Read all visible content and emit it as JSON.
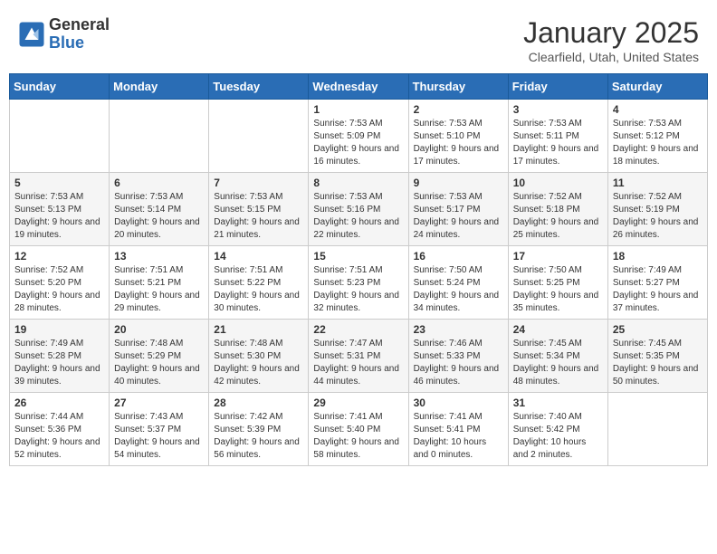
{
  "logo": {
    "general": "General",
    "blue": "Blue"
  },
  "header": {
    "month": "January 2025",
    "location": "Clearfield, Utah, United States"
  },
  "weekdays": [
    "Sunday",
    "Monday",
    "Tuesday",
    "Wednesday",
    "Thursday",
    "Friday",
    "Saturday"
  ],
  "weeks": [
    [
      {
        "day": "",
        "info": ""
      },
      {
        "day": "",
        "info": ""
      },
      {
        "day": "",
        "info": ""
      },
      {
        "day": "1",
        "sunrise": "7:53 AM",
        "sunset": "5:09 PM",
        "daylight": "9 hours and 16 minutes."
      },
      {
        "day": "2",
        "sunrise": "7:53 AM",
        "sunset": "5:10 PM",
        "daylight": "9 hours and 17 minutes."
      },
      {
        "day": "3",
        "sunrise": "7:53 AM",
        "sunset": "5:11 PM",
        "daylight": "9 hours and 17 minutes."
      },
      {
        "day": "4",
        "sunrise": "7:53 AM",
        "sunset": "5:12 PM",
        "daylight": "9 hours and 18 minutes."
      }
    ],
    [
      {
        "day": "5",
        "sunrise": "7:53 AM",
        "sunset": "5:13 PM",
        "daylight": "9 hours and 19 minutes."
      },
      {
        "day": "6",
        "sunrise": "7:53 AM",
        "sunset": "5:14 PM",
        "daylight": "9 hours and 20 minutes."
      },
      {
        "day": "7",
        "sunrise": "7:53 AM",
        "sunset": "5:15 PM",
        "daylight": "9 hours and 21 minutes."
      },
      {
        "day": "8",
        "sunrise": "7:53 AM",
        "sunset": "5:16 PM",
        "daylight": "9 hours and 22 minutes."
      },
      {
        "day": "9",
        "sunrise": "7:53 AM",
        "sunset": "5:17 PM",
        "daylight": "9 hours and 24 minutes."
      },
      {
        "day": "10",
        "sunrise": "7:52 AM",
        "sunset": "5:18 PM",
        "daylight": "9 hours and 25 minutes."
      },
      {
        "day": "11",
        "sunrise": "7:52 AM",
        "sunset": "5:19 PM",
        "daylight": "9 hours and 26 minutes."
      }
    ],
    [
      {
        "day": "12",
        "sunrise": "7:52 AM",
        "sunset": "5:20 PM",
        "daylight": "9 hours and 28 minutes."
      },
      {
        "day": "13",
        "sunrise": "7:51 AM",
        "sunset": "5:21 PM",
        "daylight": "9 hours and 29 minutes."
      },
      {
        "day": "14",
        "sunrise": "7:51 AM",
        "sunset": "5:22 PM",
        "daylight": "9 hours and 30 minutes."
      },
      {
        "day": "15",
        "sunrise": "7:51 AM",
        "sunset": "5:23 PM",
        "daylight": "9 hours and 32 minutes."
      },
      {
        "day": "16",
        "sunrise": "7:50 AM",
        "sunset": "5:24 PM",
        "daylight": "9 hours and 34 minutes."
      },
      {
        "day": "17",
        "sunrise": "7:50 AM",
        "sunset": "5:25 PM",
        "daylight": "9 hours and 35 minutes."
      },
      {
        "day": "18",
        "sunrise": "7:49 AM",
        "sunset": "5:27 PM",
        "daylight": "9 hours and 37 minutes."
      }
    ],
    [
      {
        "day": "19",
        "sunrise": "7:49 AM",
        "sunset": "5:28 PM",
        "daylight": "9 hours and 39 minutes."
      },
      {
        "day": "20",
        "sunrise": "7:48 AM",
        "sunset": "5:29 PM",
        "daylight": "9 hours and 40 minutes."
      },
      {
        "day": "21",
        "sunrise": "7:48 AM",
        "sunset": "5:30 PM",
        "daylight": "9 hours and 42 minutes."
      },
      {
        "day": "22",
        "sunrise": "7:47 AM",
        "sunset": "5:31 PM",
        "daylight": "9 hours and 44 minutes."
      },
      {
        "day": "23",
        "sunrise": "7:46 AM",
        "sunset": "5:33 PM",
        "daylight": "9 hours and 46 minutes."
      },
      {
        "day": "24",
        "sunrise": "7:45 AM",
        "sunset": "5:34 PM",
        "daylight": "9 hours and 48 minutes."
      },
      {
        "day": "25",
        "sunrise": "7:45 AM",
        "sunset": "5:35 PM",
        "daylight": "9 hours and 50 minutes."
      }
    ],
    [
      {
        "day": "26",
        "sunrise": "7:44 AM",
        "sunset": "5:36 PM",
        "daylight": "9 hours and 52 minutes."
      },
      {
        "day": "27",
        "sunrise": "7:43 AM",
        "sunset": "5:37 PM",
        "daylight": "9 hours and 54 minutes."
      },
      {
        "day": "28",
        "sunrise": "7:42 AM",
        "sunset": "5:39 PM",
        "daylight": "9 hours and 56 minutes."
      },
      {
        "day": "29",
        "sunrise": "7:41 AM",
        "sunset": "5:40 PM",
        "daylight": "9 hours and 58 minutes."
      },
      {
        "day": "30",
        "sunrise": "7:41 AM",
        "sunset": "5:41 PM",
        "daylight": "10 hours and 0 minutes."
      },
      {
        "day": "31",
        "sunrise": "7:40 AM",
        "sunset": "5:42 PM",
        "daylight": "10 hours and 2 minutes."
      },
      {
        "day": "",
        "info": ""
      }
    ]
  ]
}
